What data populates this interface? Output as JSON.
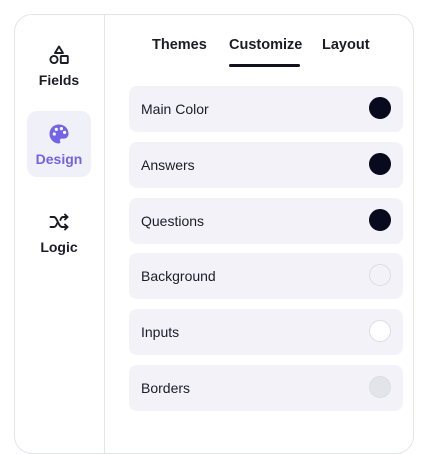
{
  "sidebar": {
    "items": [
      {
        "label": "Fields",
        "icon": "shapes-icon",
        "active": false
      },
      {
        "label": "Design",
        "icon": "palette-icon",
        "active": true
      },
      {
        "label": "Logic",
        "icon": "shuffle-icon",
        "active": false
      }
    ]
  },
  "tabs": [
    {
      "label": "Themes",
      "active": false
    },
    {
      "label": "Customize",
      "active": true
    },
    {
      "label": "Layout",
      "active": false
    }
  ],
  "colors": {
    "accent": "#7363e6",
    "active_bg": "#f0f0f8",
    "row_bg": "#f2f2f8"
  },
  "settings": [
    {
      "label": "Main Color",
      "color": "#0a0a1e"
    },
    {
      "label": "Answers",
      "color": "#0a0a1e"
    },
    {
      "label": "Questions",
      "color": "#0a0a1e"
    },
    {
      "label": "Background",
      "color": "#f2f2f8"
    },
    {
      "label": "Inputs",
      "color": "#ffffff"
    },
    {
      "label": "Borders",
      "color": "#e2e4ea"
    }
  ]
}
